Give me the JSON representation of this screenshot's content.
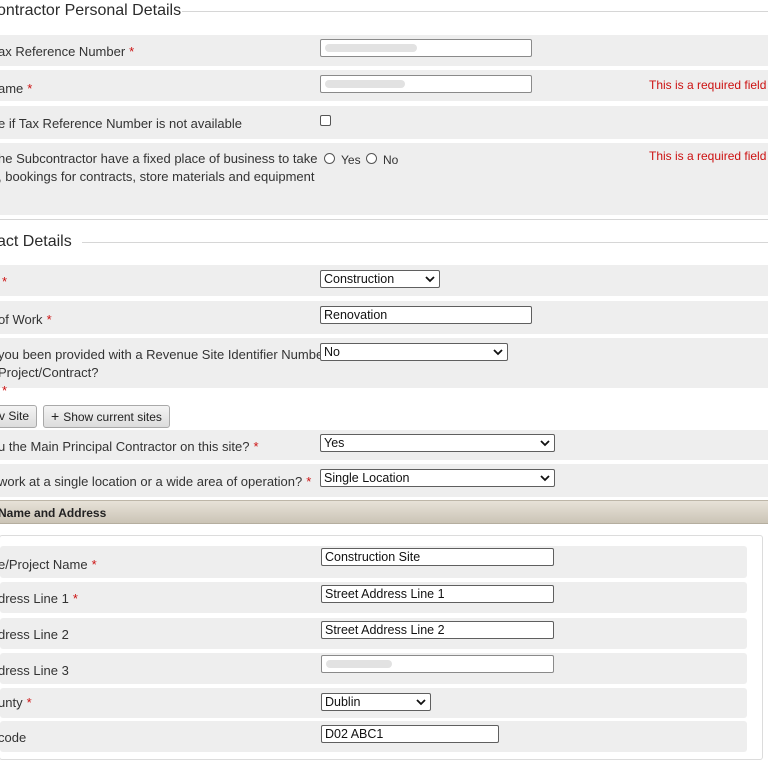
{
  "personal": {
    "title": "ontractor Personal Details",
    "tax_ref": {
      "label": "ax Reference Number",
      "required": "*"
    },
    "name": {
      "label": "ame",
      "required": "*",
      "error": "This is a required field"
    },
    "tick_no_tax": {
      "label": "e if Tax Reference Number is not available"
    },
    "fixed_place": {
      "line1": "he Subcontractor have a fixed place of business to take",
      "line2": ", bookings for contracts, store materials and equipment",
      "yes": "Yes",
      "no": "No",
      "error": "This is a required field"
    }
  },
  "contract": {
    "title": "act Details",
    "sector": {
      "label": "",
      "required": "*",
      "value": "Construction"
    },
    "nature": {
      "label": "of Work",
      "required": "*",
      "value": "Renovation"
    },
    "site_id": {
      "line1": "you been provided with a Revenue Site Identifier Number",
      "line2": " Project/Contract?",
      "required": "*",
      "value": "No"
    },
    "new_site_button": "v Site",
    "show_sites_button": "Show current sites",
    "main_contractor": {
      "label": "u the Main Principal Contractor on this site?",
      "required": "*",
      "value": "Yes"
    },
    "location": {
      "label": " work at a single location or a wide area of operation?",
      "required": "*",
      "value": "Single Location"
    }
  },
  "site": {
    "bar_title": "Name and Address",
    "project_name": {
      "label": "e/Project Name",
      "required": "*",
      "value": "Construction Site"
    },
    "addr1": {
      "label": "dress Line 1",
      "required": "*",
      "value": "Street Address Line 1"
    },
    "addr2": {
      "label": "dress Line 2",
      "value": "Street Address Line 2"
    },
    "addr3": {
      "label": "dress Line 3"
    },
    "county": {
      "label": "unty",
      "required": "*",
      "value": "Dublin"
    },
    "eircode": {
      "label": "code",
      "value": "D02 ABC1"
    }
  },
  "colors": {
    "required": "#cc1111",
    "row_background": "#eeeeee",
    "bar_background": "#d9d3c6"
  }
}
